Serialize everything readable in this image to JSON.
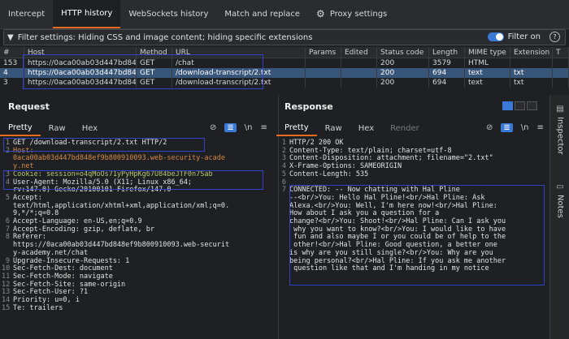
{
  "tabs": [
    "Intercept",
    "HTTP history",
    "WebSockets history",
    "Match and replace",
    "Proxy settings"
  ],
  "filter": {
    "text": "Filter settings: Hiding CSS and image content; hiding specific extensions",
    "toggle_label": "Filter on",
    "help": "?"
  },
  "table": {
    "columns": [
      "#",
      "Host",
      "Method",
      "URL",
      "Params",
      "Edited",
      "Status code",
      "Length",
      "MIME type",
      "Extension",
      "T"
    ],
    "rows": [
      [
        "153",
        "https://0aca00ab03d447bd848...",
        "GET",
        "/chat",
        "",
        "",
        "200",
        "3579",
        "HTML",
        "",
        ""
      ],
      [
        "4",
        "https://0aca00ab03d447bd848...",
        "GET",
        "/download-transcript/2.txt",
        "",
        "",
        "200",
        "694",
        "text",
        "txt",
        ""
      ],
      [
        "3",
        "https://0aca00ab03d447bd848...",
        "GET",
        "/download-transcript/2.txt",
        "",
        "",
        "200",
        "694",
        "text",
        "txt",
        ""
      ]
    ]
  },
  "request": {
    "title": "Request",
    "subtabs": [
      "Pretty",
      "Raw",
      "Hex"
    ],
    "tools": [
      "\\n",
      "≡"
    ],
    "lines": [
      {
        "no": "1",
        "text": "GET /download-transcript/2.txt HTTP/2",
        "kind": ""
      },
      {
        "no": "2",
        "text": "Host:",
        "kind": "host"
      },
      {
        "no": "",
        "text": "0aca00ab03d447bd848ef9b800910093.web-security-acade",
        "kind": "host"
      },
      {
        "no": "",
        "text": "y.net",
        "kind": "host"
      },
      {
        "no": "3",
        "text": "Cookie: session=o4qMoOs71yPyHpKg67U84beJTF0n7Sab",
        "kind": "cookie"
      },
      {
        "no": "4",
        "text": "User-Agent: Mozilla/5.0 (X11; Linux x86_64;",
        "kind": ""
      },
      {
        "no": "",
        "text": "rv:147.0) Gecko/20100101 Firefox/147.0",
        "kind": ""
      },
      {
        "no": "5",
        "text": "Accept:",
        "kind": ""
      },
      {
        "no": "",
        "text": "text/html,application/xhtml+xml,application/xml;q=0.",
        "kind": ""
      },
      {
        "no": "",
        "text": "9,*/*;q=0.8",
        "kind": ""
      },
      {
        "no": "6",
        "text": "Accept-Language: en-US,en;q=0.9",
        "kind": ""
      },
      {
        "no": "7",
        "text": "Accept-Encoding: gzip, deflate, br",
        "kind": ""
      },
      {
        "no": "8",
        "text": "Referer:",
        "kind": ""
      },
      {
        "no": "",
        "text": "https://0aca00ab03d447bd848ef9b800910093.web-securit",
        "kind": ""
      },
      {
        "no": "",
        "text": "y-academy.net/chat",
        "kind": ""
      },
      {
        "no": "9",
        "text": "Upgrade-Insecure-Requests: 1",
        "kind": ""
      },
      {
        "no": "10",
        "text": "Sec-Fetch-Dest: document",
        "kind": ""
      },
      {
        "no": "11",
        "text": "Sec-Fetch-Mode: navigate",
        "kind": ""
      },
      {
        "no": "12",
        "text": "Sec-Fetch-Site: same-origin",
        "kind": ""
      },
      {
        "no": "13",
        "text": "Sec-Fetch-User: ?1",
        "kind": ""
      },
      {
        "no": "14",
        "text": "Priority: u=0, i",
        "kind": ""
      },
      {
        "no": "15",
        "text": "Te: trailers",
        "kind": ""
      }
    ]
  },
  "response": {
    "title": "Response",
    "subtabs": [
      "Pretty",
      "Raw",
      "Hex",
      "Render"
    ],
    "tools": [
      "\\n",
      "≡"
    ],
    "lines": [
      {
        "no": "1",
        "text": "HTTP/2 200 OK"
      },
      {
        "no": "2",
        "text": "Content-Type: text/plain; charset=utf-8"
      },
      {
        "no": "3",
        "text": "Content-Disposition: attachment; filename=\"2.txt\""
      },
      {
        "no": "4",
        "text": "X-Frame-Options: SAMEORIGIN"
      },
      {
        "no": "5",
        "text": "Content-Length: 535"
      },
      {
        "no": "6",
        "text": ""
      },
      {
        "no": "7",
        "text": "CONNECTED: -- Now chatting with Hal Pline"
      },
      {
        "no": "",
        "text": "--<br/>You: Hello Hal Pline!<br/>Hal Pline: Ask"
      },
      {
        "no": "",
        "text": "Alexa.<br/>You: Well, I'm here now!<br/>Hal Pline:"
      },
      {
        "no": "",
        "text": "How about I ask you a question for a"
      },
      {
        "no": "",
        "text": "change?<br/>You: Shoot!<br/>Hal Pline: Can I ask you"
      },
      {
        "no": "",
        "text": " why you want to know?<br/>You: I would like to have"
      },
      {
        "no": "",
        "text": " fun and also maybe I or you could be of help to the"
      },
      {
        "no": "",
        "text": " other!<br/>Hal Pline: Good question, a better one"
      },
      {
        "no": "",
        "text": "is why are you still single?<br/>You: Why are you"
      },
      {
        "no": "",
        "text": "being personal?<br/>Hal Pline: If you ask me another"
      },
      {
        "no": "",
        "text": " question like that and I'm handing in my notice"
      }
    ]
  },
  "sidebar": [
    "Inspector",
    "Notes"
  ],
  "colors": {
    "accent": "#e46b1d",
    "selection": "#38557a",
    "annotation": "#3043c8",
    "toggle": "#3b79d6"
  }
}
